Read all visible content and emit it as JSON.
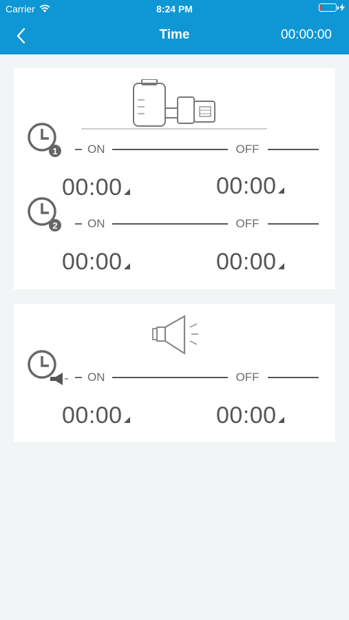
{
  "status": {
    "carrier": "Carrier",
    "time": "8:24 PM"
  },
  "nav": {
    "title": "Time",
    "clock": "00:00:00"
  },
  "pump_card": {
    "timers": [
      {
        "index": "1",
        "on_label": "ON",
        "off_label": "OFF",
        "on_time": "00:00",
        "off_time": "00:00"
      },
      {
        "index": "2",
        "on_label": "ON",
        "off_label": "OFF",
        "on_time": "00:00",
        "off_time": "00:00"
      }
    ]
  },
  "alarm_card": {
    "timer": {
      "on_label": "ON",
      "off_label": "OFF",
      "on_time": "00:00",
      "off_time": "00:00"
    }
  },
  "colors": {
    "accent": "#0f96d4",
    "background": "#f1f5f5",
    "card": "#ffffff",
    "text": "#555555"
  }
}
